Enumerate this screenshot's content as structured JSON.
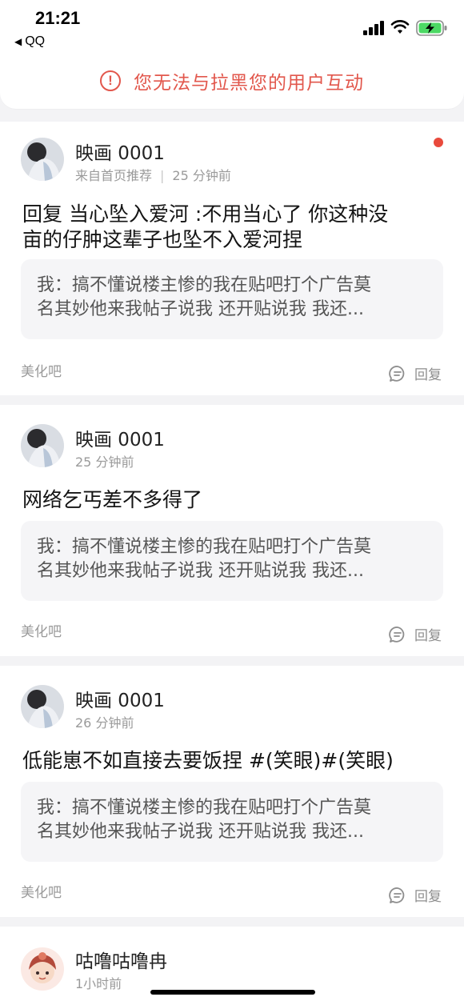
{
  "status_bar": {
    "time": "21:21",
    "back_app": "QQ",
    "icons": [
      "cellular-signal-icon",
      "wifi-icon",
      "battery-charging-icon"
    ],
    "battery_color": "#4cd964"
  },
  "notice": {
    "text": "您无法与拉黑您的用户互动",
    "icon": "exclamation-circle-icon",
    "color": "#e2574c"
  },
  "posts": [
    {
      "username": "映画 0001",
      "source": "来自首页推荐",
      "time": "25 分钟前",
      "unread": true,
      "content_line1": "回复 当心坠入爱河 :不用当心了 你这种没",
      "content_line2": "亩的仔肿这辈子也坠不入爱河捏",
      "quote_line1": "我：搞不懂说楼主惨的我在贴吧打个广告莫",
      "quote_line2": "名其妙他来我帖子说我 还开贴说我 我还...",
      "forum": "美化吧",
      "reply_label": "回复"
    },
    {
      "username": "映画 0001",
      "time": "25 分钟前",
      "unread": false,
      "content_line1": "网络乞丐差不多得了",
      "quote_line1": "我：搞不懂说楼主惨的我在贴吧打个广告莫",
      "quote_line2": "名其妙他来我帖子说我 还开贴说我 我还...",
      "forum": "美化吧",
      "reply_label": "回复"
    },
    {
      "username": "映画 0001",
      "time": "26 分钟前",
      "unread": false,
      "content_line1": "低能崽不如直接去要饭捏 #(笑眼)#(笑眼)",
      "quote_line1": "我：搞不懂说楼主惨的我在贴吧打个广告莫",
      "quote_line2": "名其妙他来我帖子说我 还开贴说我 我还...",
      "forum": "美化吧",
      "reply_label": "回复"
    },
    {
      "username": "咕噜咕噜冉",
      "time": "1小时前",
      "unread": false
    }
  ],
  "accent": "#e94a3c"
}
